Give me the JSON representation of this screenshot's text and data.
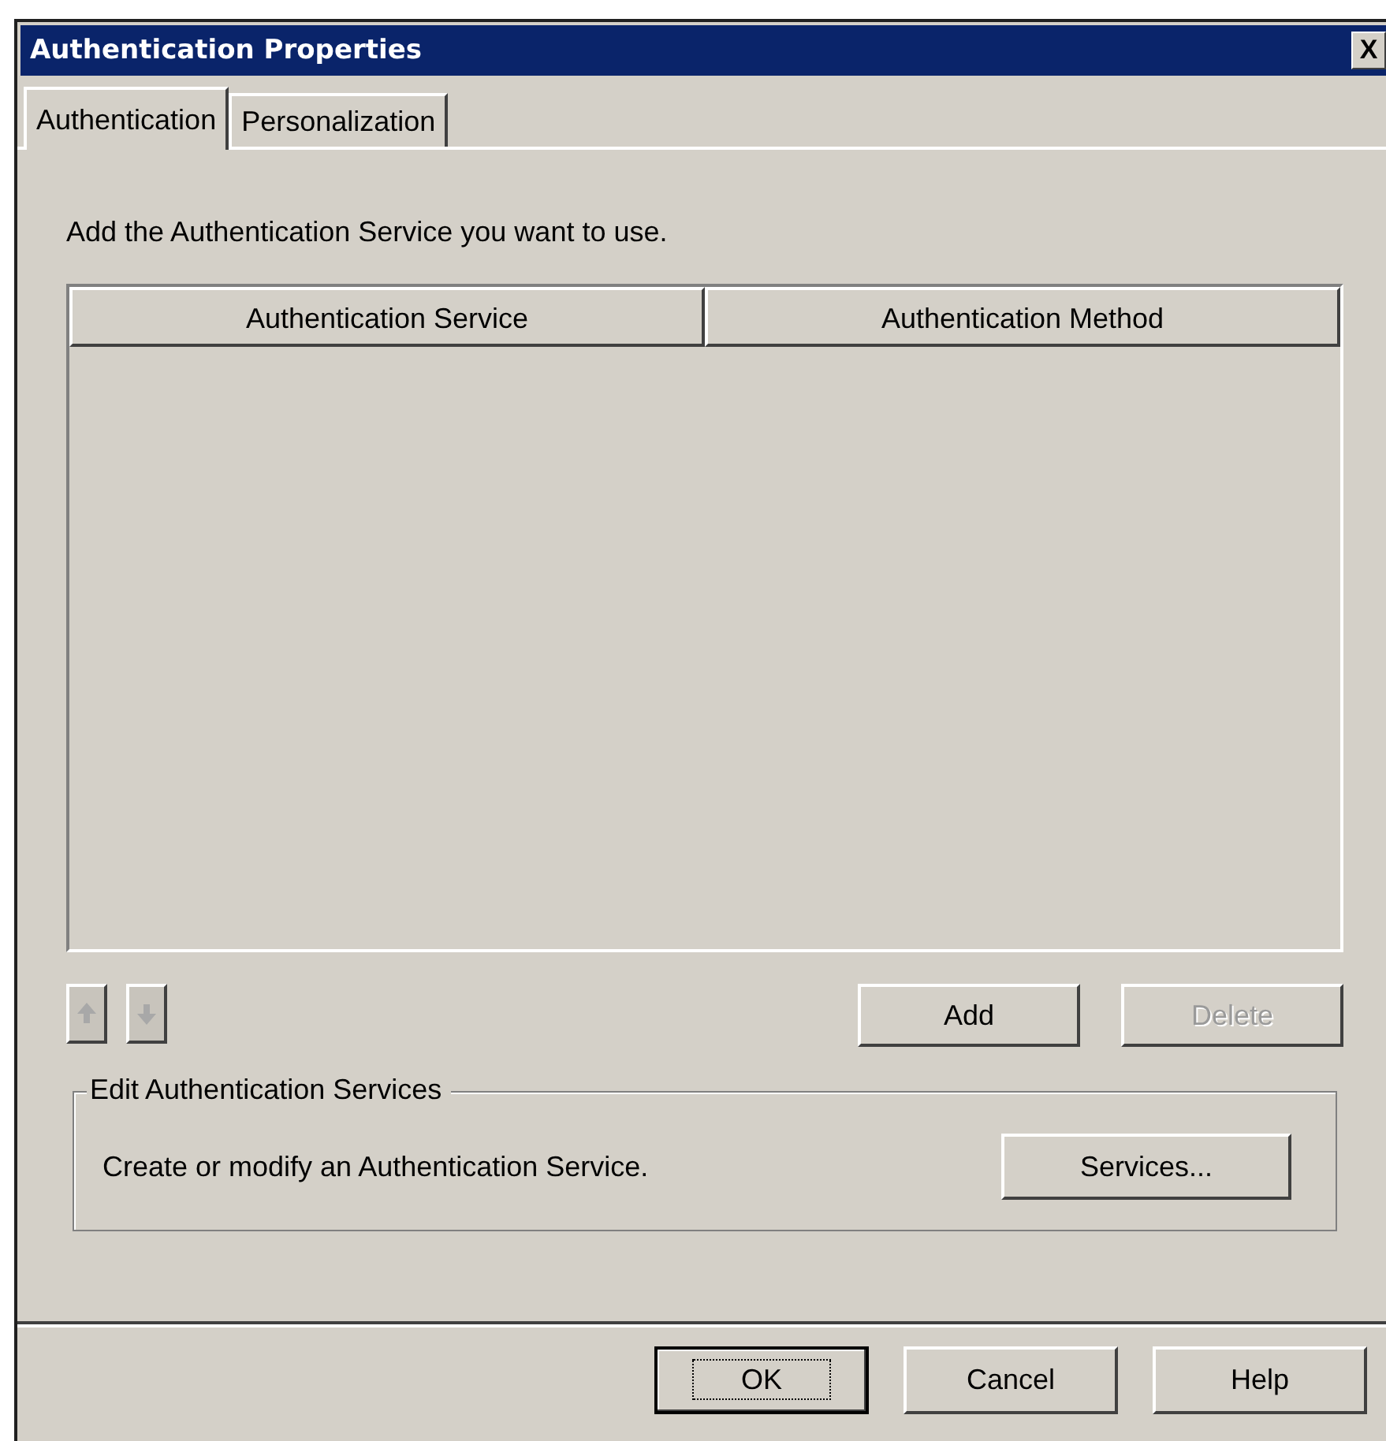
{
  "window": {
    "title": "Authentication Properties",
    "close_glyph": "X"
  },
  "tabs": [
    {
      "label": "Authentication",
      "selected": true
    },
    {
      "label": "Personalization",
      "selected": false
    }
  ],
  "instruction": "Add the Authentication Service you want to use.",
  "table": {
    "columns": [
      "Authentication Service",
      "Authentication Method"
    ]
  },
  "move_buttons": [
    {
      "kind": "up",
      "disabled": true
    },
    {
      "kind": "down",
      "disabled": true
    }
  ],
  "list_buttons": [
    {
      "label": "Add",
      "disabled": false
    },
    {
      "label": "Delete",
      "disabled": true
    }
  ],
  "group": {
    "title": "Edit Authentication Services",
    "description": "Create or modify an Authentication Service.",
    "button": "Services..."
  },
  "footer_buttons": [
    {
      "label": "OK",
      "default": true
    },
    {
      "label": "Cancel",
      "default": false
    },
    {
      "label": "Help",
      "default": false
    }
  ]
}
